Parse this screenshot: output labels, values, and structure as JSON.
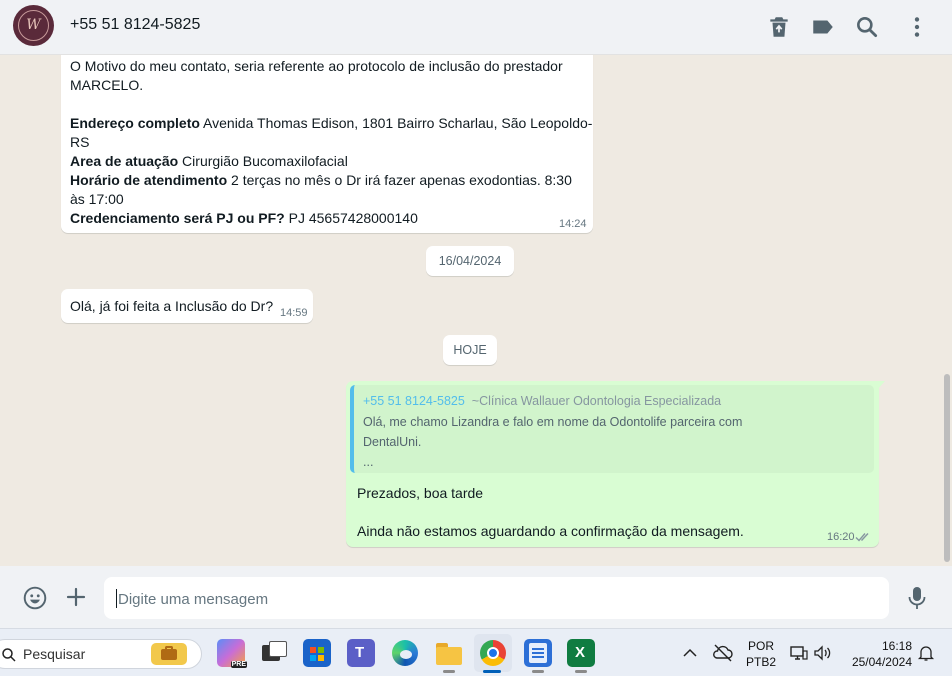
{
  "header": {
    "contact_name": "+55 51 8124-5825",
    "avatar_icon": "clinic-logo-avatar",
    "icons": [
      "delete-icon",
      "label-icon",
      "search-icon",
      "more-vertical-icon"
    ]
  },
  "messages": {
    "m1": {
      "line1": "O Motivo do meu contato, seria referente ao protocolo de inclusão do prestador",
      "line2": "MARCELO.",
      "address_label": "Endereço completo",
      "address_value1": " Avenida Thomas Edison, 1801 Bairro Scharlau, São Leopoldo-",
      "address_value2": "RS",
      "area_label": "Area de atuação",
      "area_value": " Cirurgião  Bucomaxilofacial",
      "hours_label": "Horário de atendimento",
      "hours_value1": " 2 terças no mês o Dr irá fazer apenas exodontias. 8:30",
      "hours_value2": "às 17:00",
      "cred_label": "Credenciamento será PJ ou PF?",
      "cred_value": " PJ 45657428000140",
      "time": "14:24"
    },
    "date_chip": "16/04/2024",
    "m2": {
      "text": "Olá, já foi feita a Inclusão do Dr?",
      "time": "14:59"
    },
    "today_chip": "HOJE",
    "m3": {
      "quote_author": "+55 51 8124-5825",
      "quote_org": "~Clínica Wallauer Odontologia Especializada",
      "quote_line1": "Olá, me chamo Lizandra e falo em nome da Odontolife parceira com",
      "quote_line2": "DentalUni.",
      "quote_line3": "...",
      "line1": "Prezados, boa tarde",
      "line2": "Ainda não estamos aguardando a confirmação da mensagem.",
      "time": "16:20",
      "status_icon": "double-check-icon"
    }
  },
  "composer": {
    "placeholder": "Digite uma mensagem",
    "icons": [
      "emoji-icon",
      "plus-icon",
      "microphone-icon"
    ]
  },
  "taskbar": {
    "search_label": "Pesquisar",
    "language": "POR",
    "layout": "PTB2",
    "time": "16:18",
    "date": "25/04/2024",
    "colors": {
      "accent": "#00a884",
      "bubble_out": "#d9fdd3",
      "quote_bar": "#53bdeb"
    }
  }
}
